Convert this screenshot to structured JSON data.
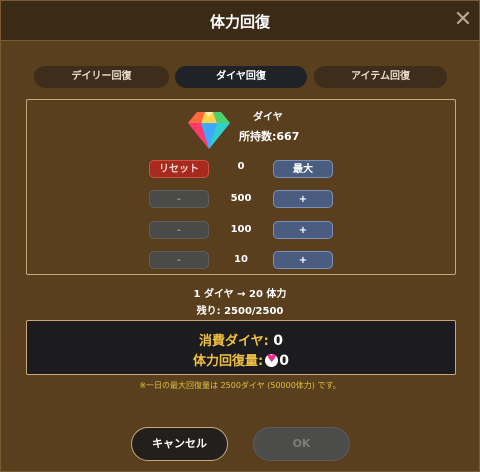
{
  "dialog": {
    "title": "体力回復",
    "close_icon": "close-icon"
  },
  "tabs": [
    {
      "label": "デイリー回復",
      "active": false
    },
    {
      "label": "ダイヤ回復",
      "active": true
    },
    {
      "label": "アイテム回復",
      "active": false
    }
  ],
  "item": {
    "icon": "diamond-icon",
    "name": "ダイヤ",
    "owned_label": "所持数:",
    "owned_value": "667"
  },
  "controls": {
    "reset_label": "リセット",
    "current_value": "0",
    "max_label": "最大",
    "minus_label": "-",
    "plus_label": "+",
    "steps": [
      "500",
      "100",
      "10"
    ]
  },
  "rate": {
    "conversion": "1 ダイヤ → 20 体力",
    "remaining": "残り: 2500/2500"
  },
  "summary": {
    "cost_label": "消費ダイヤ:",
    "cost_value": "0",
    "recover_label": "体力回復量:",
    "recover_icon": "heart-icon",
    "recover_value": "0"
  },
  "note": "※一日の最大回復量は 2500ダイヤ (50000体力) です。",
  "footer": {
    "cancel_label": "キャンセル",
    "ok_label": "OK"
  },
  "colors": {
    "background": "#5a3f1f",
    "header": "#3b2a15",
    "accent_gold": "#f0c040",
    "reset_red": "#a82a1e",
    "plus_blue": "#4a5d80"
  }
}
